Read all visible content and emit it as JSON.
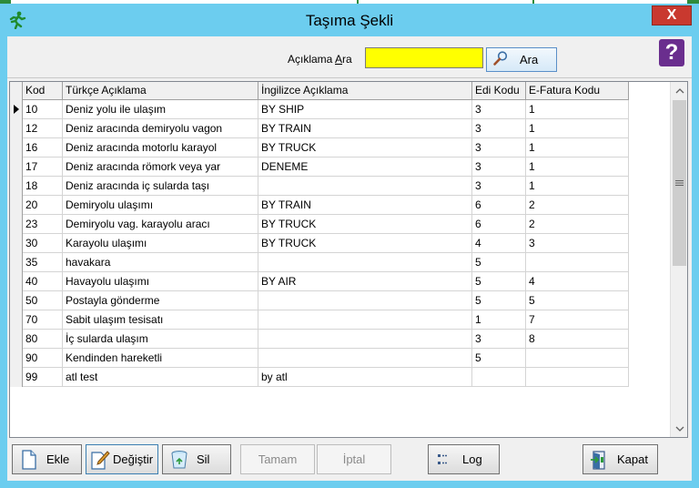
{
  "window": {
    "title": "Taşıma Şekli",
    "close_label": "X",
    "help_label": "?"
  },
  "search": {
    "label_before": "Açıklama ",
    "label_accel": "A",
    "label_after": "ra",
    "value": "",
    "button_label": "Ara"
  },
  "grid": {
    "columns": [
      "Kod",
      "Türkçe Açıklama",
      "İngilizce Açıklama",
      "Edi Kodu",
      "E-Fatura Kodu"
    ],
    "rows": [
      {
        "kod": "10",
        "tr": "Deniz yolu ile ulaşım",
        "en": "BY SHIP",
        "edi": "3",
        "ef": "1"
      },
      {
        "kod": "12",
        "tr": "Deniz aracında demiryolu vagon",
        "en": "BY TRAIN",
        "edi": "3",
        "ef": "1"
      },
      {
        "kod": "16",
        "tr": "Deniz aracında motorlu karayol",
        "en": "BY TRUCK",
        "edi": "3",
        "ef": "1"
      },
      {
        "kod": "17",
        "tr": "Deniz aracında römork veya yar",
        "en": "DENEME",
        "edi": "3",
        "ef": "1"
      },
      {
        "kod": "18",
        "tr": "Deniz aracında iç sularda taşı",
        "en": "",
        "edi": "3",
        "ef": "1"
      },
      {
        "kod": "20",
        "tr": "Demiryolu ulaşımı",
        "en": "BY TRAIN",
        "edi": "6",
        "ef": "2"
      },
      {
        "kod": "23",
        "tr": "Demiryolu vag. karayolu aracı",
        "en": "BY TRUCK",
        "edi": "6",
        "ef": "2"
      },
      {
        "kod": "30",
        "tr": "Karayolu ulaşımı",
        "en": "BY TRUCK",
        "edi": "4",
        "ef": "3"
      },
      {
        "kod": "35",
        "tr": "havakara",
        "en": "",
        "edi": "5",
        "ef": ""
      },
      {
        "kod": "40",
        "tr": "Havayolu ulaşımı",
        "en": "BY AIR",
        "edi": "5",
        "ef": "4"
      },
      {
        "kod": "50",
        "tr": "Postayla gönderme",
        "en": "",
        "edi": "5",
        "ef": "5"
      },
      {
        "kod": "70",
        "tr": "Sabit ulaşım tesisatı",
        "en": "",
        "edi": "1",
        "ef": "7"
      },
      {
        "kod": "80",
        "tr": "İç sularda ulaşım",
        "en": "",
        "edi": "3",
        "ef": "8"
      },
      {
        "kod": "90",
        "tr": "Kendinden hareketli",
        "en": "",
        "edi": "5",
        "ef": ""
      },
      {
        "kod": "99",
        "tr": "atl test",
        "en": "by atl",
        "edi": "",
        "ef": ""
      }
    ]
  },
  "footer": {
    "ekle": "Ekle",
    "degistir": "Değiştir",
    "sil": "Sil",
    "tamam": "Tamam",
    "iptal": "İptal",
    "log": "Log",
    "kapat": "Kapat"
  },
  "colors": {
    "titlebar": "#6ccdef",
    "close": "#c9392f",
    "search_field": "#ffff00",
    "help": "#6a2e8e"
  },
  "icons": {
    "app": "running-man-icon",
    "search": "magnifier-icon",
    "ekle": "new-document-icon",
    "degistir": "edit-pencil-icon",
    "sil": "recycle-bin-icon",
    "log": "list-icon",
    "kapat": "exit-door-icon"
  }
}
